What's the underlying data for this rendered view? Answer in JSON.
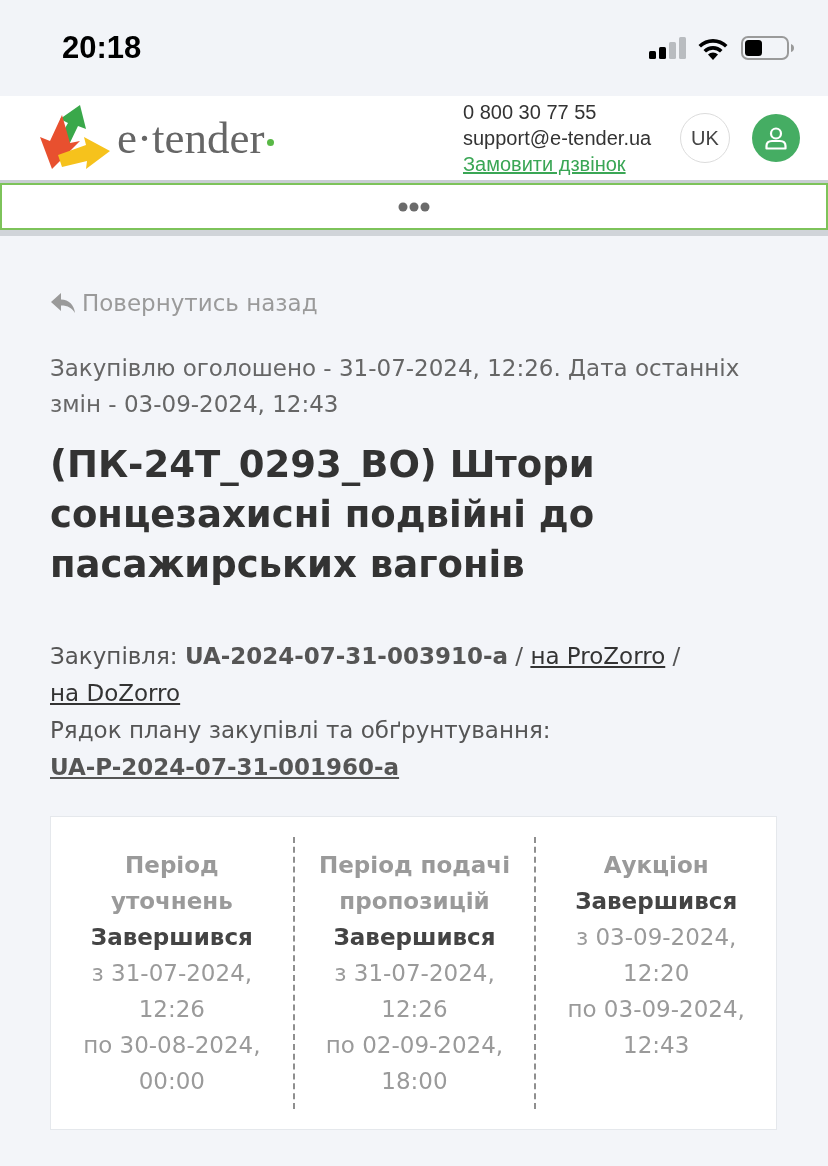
{
  "status_bar": {
    "time": "20:18"
  },
  "header": {
    "logo_text": "e·tender",
    "phone": "0 800 30 77 55",
    "email": "support@e-tender.ua",
    "callback_link": "Замовити дзвінок",
    "language": "UK"
  },
  "back_link": "Повернутись назад",
  "dates_note": "Закупівлю оголошено - 31-07-2024, 12:26. Дата останніх змін - 03-09-2024, 12:43",
  "title": "(ПК-24Т_0293_ВО) Штори сонцезахисні подвійні до пасажирських вагонів",
  "procurement": {
    "label": "Закупівля:",
    "id": "UA-2024-07-31-003910-a",
    "links": [
      {
        "separator": "/",
        "label": "на ProZorro"
      },
      {
        "separator": "/",
        "label": "на DoZorro"
      }
    ]
  },
  "plan": {
    "label": "Рядок плану закупівлі та обґрунтування:",
    "id": "UA-P-2024-07-31-001960-a"
  },
  "periods": [
    {
      "name": "Період уточнень",
      "status": "Завершився",
      "from": "з 31-07-2024, 12:26",
      "to": "по 30-08-2024, 00:00"
    },
    {
      "name": "Період подачі пропозицій",
      "status": "Завершився",
      "from": "з 31-07-2024, 12:26",
      "to": "по 02-09-2024, 18:00"
    },
    {
      "name": "Аукціон",
      "status": "Завершився",
      "from": "з 03-09-2024, 12:20",
      "to": "по 03-09-2024, 12:43"
    }
  ]
}
